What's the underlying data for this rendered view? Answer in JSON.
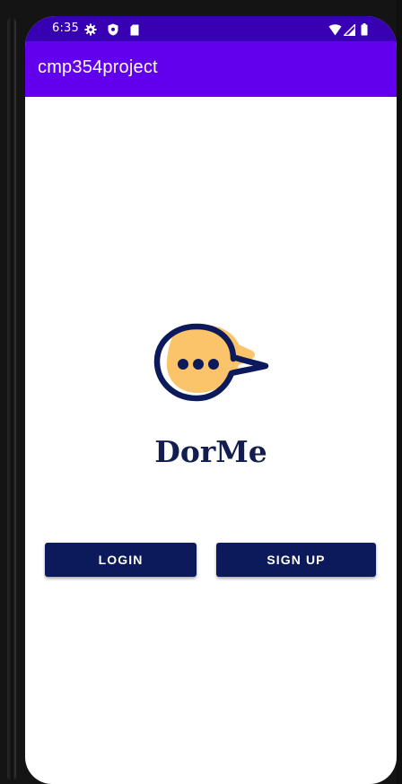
{
  "status_bar": {
    "time": "6:35",
    "left_icons": [
      "settings-icon",
      "shield-icon",
      "sim-card-icon"
    ],
    "right_icons": [
      "wifi-icon",
      "signal-icon",
      "battery-icon"
    ]
  },
  "app_bar": {
    "title": "cmp354project"
  },
  "logo": {
    "brand_name": "DorMe",
    "icon": "chat-bubble-icon"
  },
  "buttons": {
    "login_label": "LOGIN",
    "signup_label": "SIGN UP"
  },
  "colors": {
    "status_bar": "#3700b3",
    "app_bar": "#6200ee",
    "button": "#0c1a5b",
    "brand_text": "#131d4f",
    "logo_accent": "#fcc46a"
  }
}
